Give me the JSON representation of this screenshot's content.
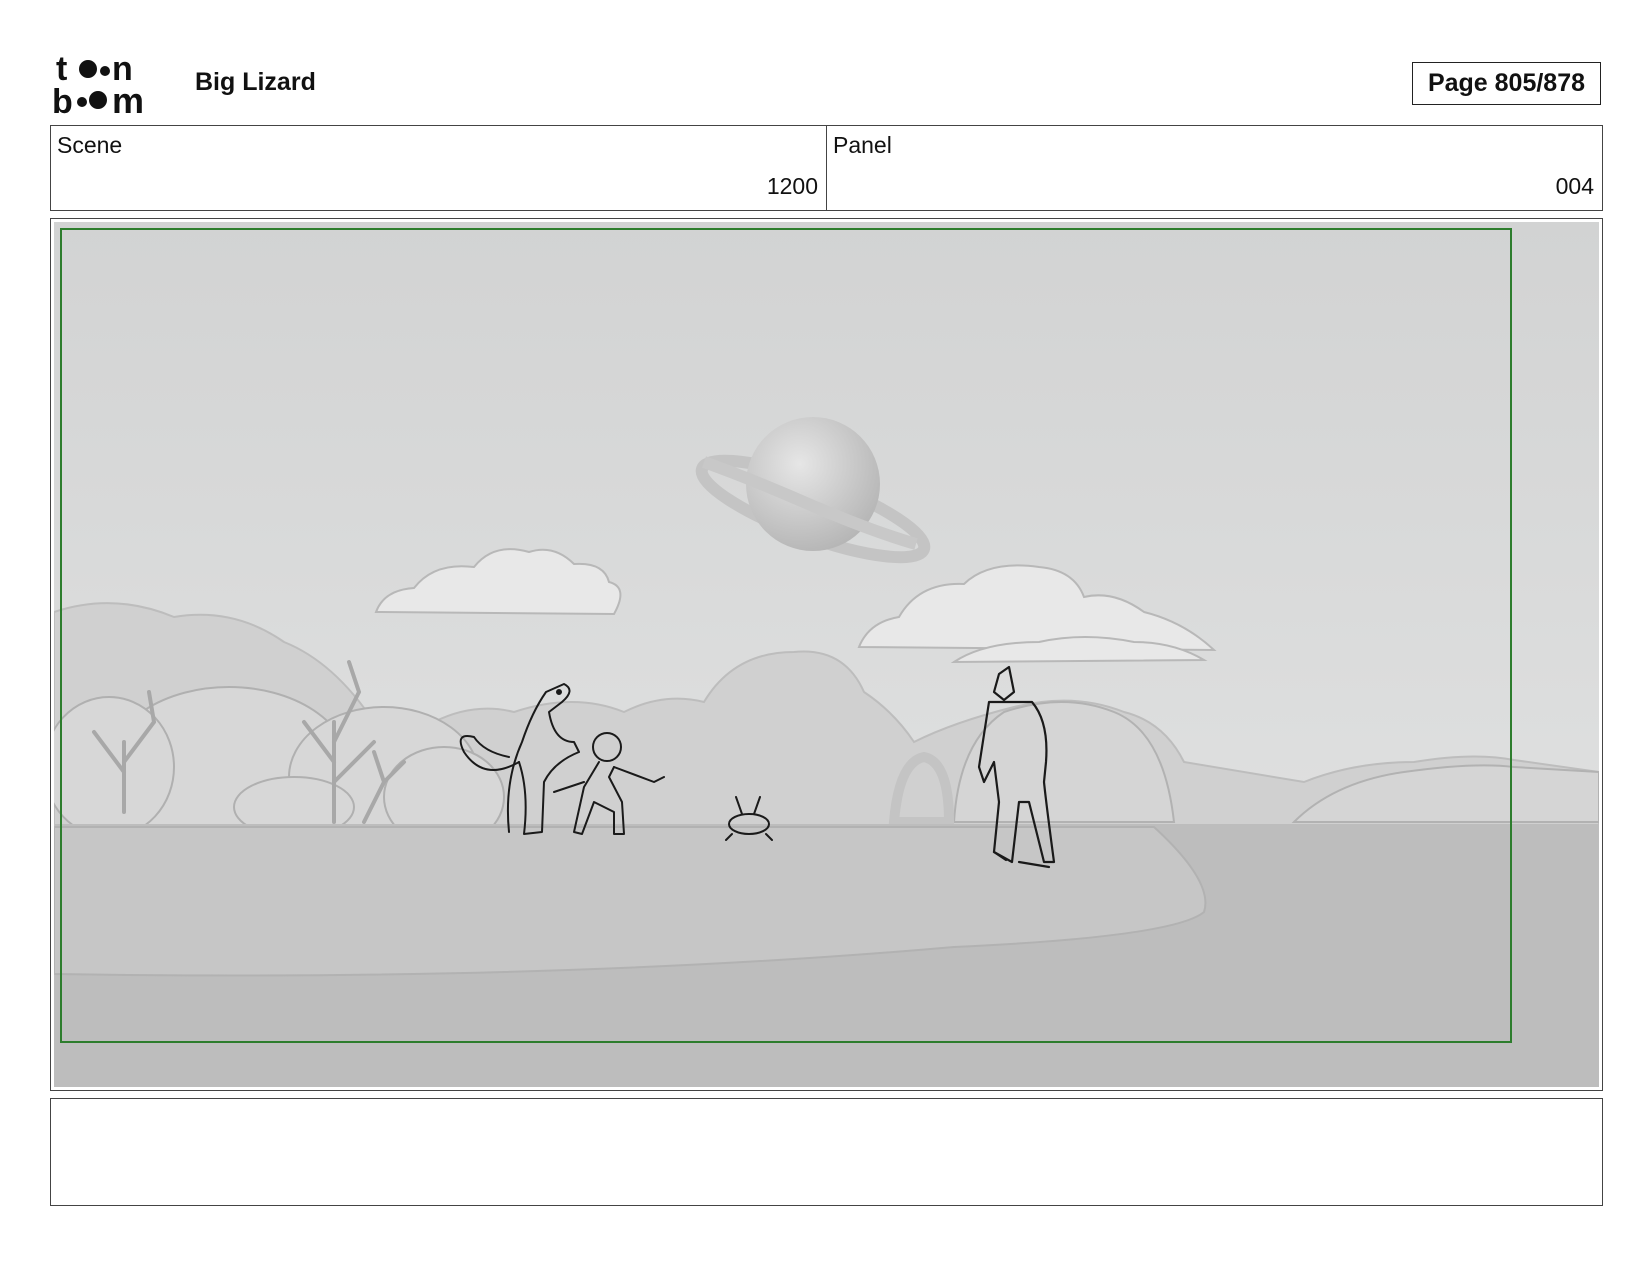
{
  "header": {
    "logo_text": "toon boom",
    "project_title": "Big Lizard",
    "page_label": "Page 805/878"
  },
  "scene": {
    "label": "Scene",
    "value": "1200"
  },
  "panel": {
    "label": "Panel",
    "value": "004"
  },
  "notes": {
    "text": ""
  }
}
